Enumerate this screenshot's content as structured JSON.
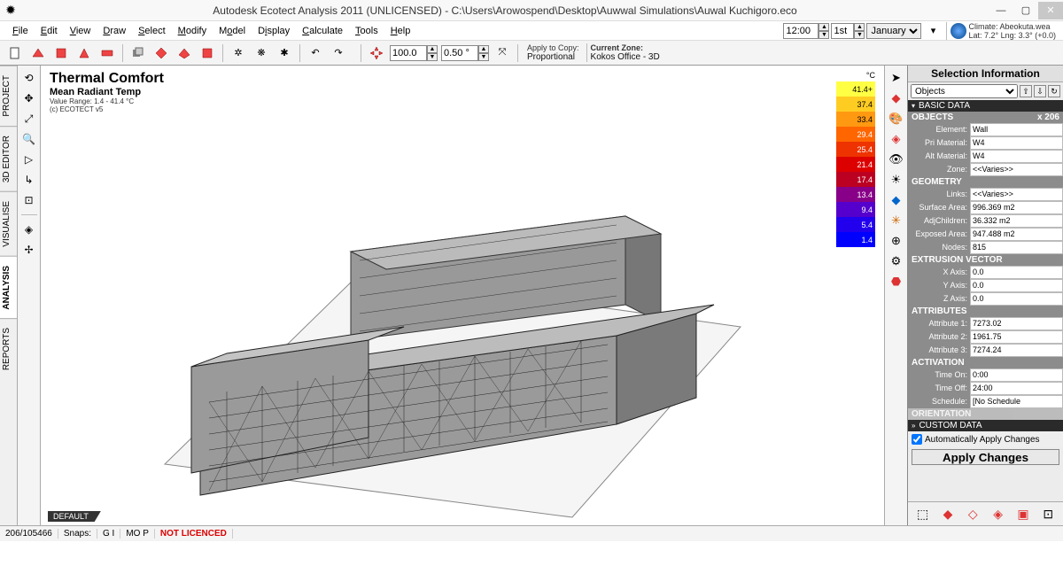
{
  "window": {
    "title": "Autodesk Ecotect Analysis 2011 (UNLICENSED) - C:\\Users\\Arowospend\\Desktop\\Auwwal Simulations\\Auwal Kuchigoro.eco"
  },
  "menu": [
    "File",
    "Edit",
    "View",
    "Draw",
    "Select",
    "Modify",
    "Model",
    "Display",
    "Calculate",
    "Tools",
    "Help"
  ],
  "toolbar1": {
    "time": "12:00",
    "day": "1st",
    "month": "January",
    "climate_name": "Climate: Abeokuta.wea",
    "climate_loc": "Lat: 7.2°    Lng: 3.3° (+0.0)"
  },
  "toolbar2": {
    "dist": "100.0",
    "angle": "0.50 °",
    "apply_lbl": "Apply to Copy:",
    "apply_val": "Proportional",
    "zone_lbl": "Current Zone:",
    "zone_val": "Kokos Office - 3D"
  },
  "sidetabs": [
    "PROJECT",
    "3D EDITOR",
    "VISUALISE",
    "ANALYSIS",
    "REPORTS"
  ],
  "canvas": {
    "title": "Thermal Comfort",
    "sub": "Mean Radiant Temp",
    "range": "Value Range: 1.4 - 41.4 °C",
    "credit": "(c) ECOTECT v5",
    "scale_unit": "°C",
    "scale": [
      {
        "v": "41.4+",
        "c": "#ffff44"
      },
      {
        "v": "37.4",
        "c": "#ffcc22"
      },
      {
        "v": "33.4",
        "c": "#ff9911"
      },
      {
        "v": "29.4",
        "c": "#ff6600"
      },
      {
        "v": "25.4",
        "c": "#ee3300"
      },
      {
        "v": "21.4",
        "c": "#dd0000"
      },
      {
        "v": "17.4",
        "c": "#bb0022"
      },
      {
        "v": "13.4",
        "c": "#880088"
      },
      {
        "v": "9.4",
        "c": "#5500cc"
      },
      {
        "v": "5.4",
        "c": "#2200ee"
      },
      {
        "v": "1.4",
        "c": "#0000ff"
      }
    ],
    "default_tag": "DEFAULT"
  },
  "panel": {
    "title": "Selection Information",
    "selector": "Objects",
    "basic_hdr": "BASIC DATA",
    "objects_hdr": "OBJECTS",
    "objects_count": "x 206",
    "element": "Wall",
    "pri_mat": "W4",
    "alt_mat": "W4",
    "zone": "<<Varies>>",
    "geom_hdr": "GEOMETRY",
    "links": "<<Varies>>",
    "surf_area": "996.369 m2",
    "adj_children": "36.332 m2",
    "exp_area": "947.488 m2",
    "nodes": "815",
    "extr_hdr": "EXTRUSION VECTOR",
    "x": "0.0",
    "y": "0.0",
    "z": "0.0",
    "attr_hdr": "ATTRIBUTES",
    "a1": "7273.02",
    "a2": "1961.75",
    "a3": "7274.24",
    "act_hdr": "ACTIVATION",
    "t_on": "0:00",
    "t_off": "24:00",
    "sched": "[No Schedule",
    "orient_hdr": "ORIENTATION",
    "custom_hdr": "CUSTOM DATA",
    "auto_chk": "Automatically Apply Changes",
    "apply_btn": "Apply Changes"
  },
  "status": {
    "coords": "206/105466",
    "snaps": "Snaps:",
    "gi": "G I",
    "mop": "MO P",
    "license": "NOT LICENCED"
  }
}
